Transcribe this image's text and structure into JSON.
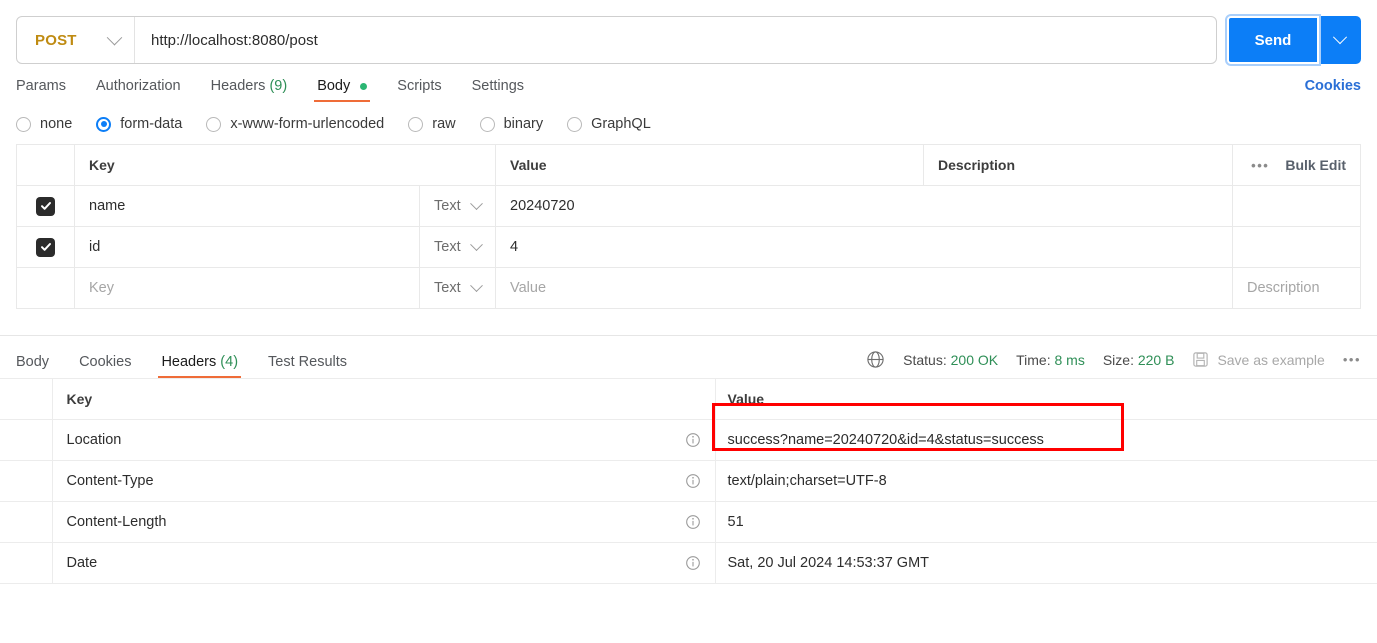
{
  "request": {
    "method": "POST",
    "method_icon": "chevron-down-icon",
    "url": "http://localhost:8080/post",
    "send_label": "Send",
    "send_caret_icon": "chevron-down-icon",
    "tabs": [
      {
        "label": "Params",
        "active": false
      },
      {
        "label": "Authorization",
        "active": false
      },
      {
        "label": "Headers",
        "count": "(9)",
        "active": false
      },
      {
        "label": "Body",
        "active": true,
        "dot": true
      },
      {
        "label": "Scripts",
        "active": false
      },
      {
        "label": "Settings",
        "active": false
      }
    ],
    "cookies_link": "Cookies",
    "body_types": [
      {
        "label": "none",
        "selected": false
      },
      {
        "label": "form-data",
        "selected": true
      },
      {
        "label": "x-www-form-urlencoded",
        "selected": false
      },
      {
        "label": "raw",
        "selected": false
      },
      {
        "label": "binary",
        "selected": false
      },
      {
        "label": "GraphQL",
        "selected": false
      }
    ],
    "form_data": {
      "headers": {
        "key": "Key",
        "value": "Value",
        "description": "Description",
        "more_icon": "more-horizontal-icon",
        "bulk_edit": "Bulk Edit"
      },
      "rows": [
        {
          "checked": true,
          "key": "name",
          "type": "Text",
          "value": "20240720",
          "description": ""
        },
        {
          "checked": true,
          "key": "id",
          "type": "Text",
          "value": "4",
          "description": ""
        }
      ],
      "placeholder_row": {
        "checked": false,
        "key": "Key",
        "type": "Text",
        "value": "Value",
        "description": "Description"
      }
    }
  },
  "response": {
    "tabs": [
      {
        "label": "Body",
        "active": false
      },
      {
        "label": "Cookies",
        "active": false
      },
      {
        "label": "Headers",
        "count": "(4)",
        "active": true
      },
      {
        "label": "Test Results",
        "active": false
      }
    ],
    "meta": {
      "globe_icon": "globe-icon",
      "status_label": "Status:",
      "status_value": "200 OK",
      "time_label": "Time:",
      "time_value": "8 ms",
      "size_label": "Size:",
      "size_value": "220 B",
      "save_icon": "save-icon",
      "save_label": "Save as example",
      "more_icon": "more-horizontal-icon"
    },
    "headers_table": {
      "columns": {
        "key": "Key",
        "value": "Value"
      },
      "rows": [
        {
          "key": "Location",
          "value": "success?name=20240720&id=4&status=success",
          "info_icon": "info-icon",
          "highlighted": true
        },
        {
          "key": "Content-Type",
          "value": "text/plain;charset=UTF-8",
          "info_icon": "info-icon",
          "highlighted": false
        },
        {
          "key": "Content-Length",
          "value": "51",
          "info_icon": "info-icon",
          "highlighted": false
        },
        {
          "key": "Date",
          "value": "Sat, 20 Jul 2024 14:53:37 GMT",
          "info_icon": "info-icon",
          "highlighted": false
        }
      ]
    }
  },
  "colors": {
    "method_accent": "#bf8b12",
    "send_blue": "#0c7ef7",
    "tab_underline": "#ef6c38",
    "status_green": "#2f8f57",
    "body_dot_green": "#2bb673",
    "cookies_blue": "#2a6fd6",
    "highlight_red": "#ff0000"
  }
}
